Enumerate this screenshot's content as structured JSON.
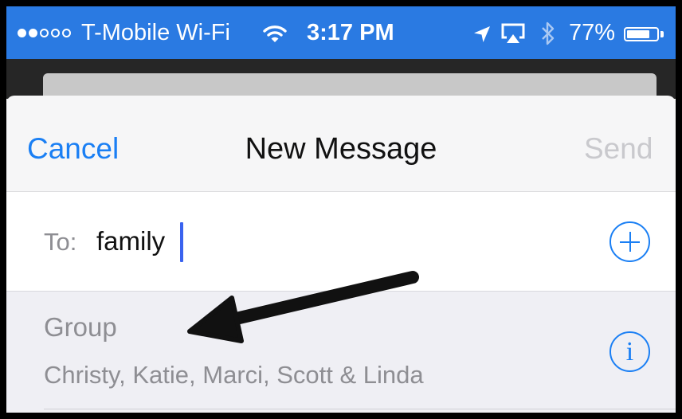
{
  "status_bar": {
    "carrier": "T-Mobile Wi-Fi",
    "time": "3:17 PM",
    "battery": "77%",
    "battery_level": 0.77,
    "signal_bars": 2,
    "icons": [
      "wifi-icon",
      "location-arrow-icon",
      "airplay-icon",
      "bluetooth-icon",
      "battery-icon"
    ]
  },
  "nav": {
    "cancel": "Cancel",
    "title": "New Message",
    "send": "Send"
  },
  "recipient": {
    "label": "To:",
    "value": "family"
  },
  "suggestion": {
    "title": "Group",
    "members": "Christy, Katie, Marci, Scott & Linda"
  },
  "colors": {
    "accent": "#1a7ff4",
    "status_bar": "#2a7ae2",
    "disabled": "#c9c9cd",
    "secondary_text": "#8e8e93"
  },
  "annotation": {
    "icon": "arrow-annotation-icon"
  }
}
